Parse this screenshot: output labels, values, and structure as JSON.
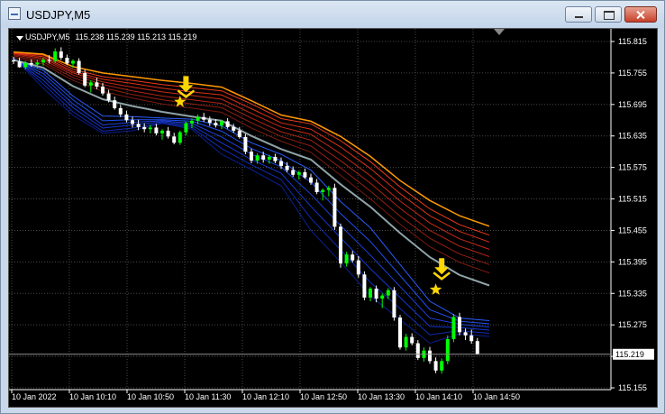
{
  "window": {
    "title": "USDJPY,M5"
  },
  "chart_header": {
    "symbol": "USDJPY,M5",
    "ohlc": "115.238 115.239 115.213 115.219"
  },
  "chart_data": {
    "type": "candlestick",
    "y_ticks": [
      "115.815",
      "115.755",
      "115.695",
      "115.635",
      "115.575",
      "115.515",
      "115.455",
      "115.395",
      "115.335",
      "115.275",
      "115.215",
      "115.155"
    ],
    "x_ticks": [
      "10 Jan 2022",
      "10 Jan 10:10",
      "10 Jan 10:50",
      "10 Jan 11:30",
      "10 Jan 12:10",
      "10 Jan 12:50",
      "10 Jan 13:30",
      "10 Jan 14:10",
      "10 Jan 14:50"
    ],
    "ylim": [
      115.155,
      115.815
    ],
    "current_price": "115.219",
    "grid": true,
    "colors": {
      "background": "#000000",
      "bull": "#00ff00",
      "bear": "#ffffff",
      "grid": "#4a4a4a",
      "signal": "#ffd700",
      "ema_fast": "#0033ff",
      "ema_slow": "#ff2a00",
      "ema_top": "#ff9900",
      "ema_mid": "#8fa3a8"
    },
    "candles": [
      [
        115.779,
        115.786,
        115.772,
        115.777
      ],
      [
        115.777,
        115.784,
        115.765,
        115.766
      ],
      [
        115.766,
        115.778,
        115.762,
        115.774
      ],
      [
        115.774,
        115.781,
        115.767,
        115.771
      ],
      [
        115.771,
        115.78,
        115.764,
        115.775
      ],
      [
        115.775,
        115.784,
        115.769,
        115.78
      ],
      [
        115.78,
        115.789,
        115.773,
        115.778
      ],
      [
        115.778,
        115.802,
        115.774,
        115.796
      ],
      [
        115.796,
        115.804,
        115.78,
        115.784
      ],
      [
        115.784,
        115.79,
        115.77,
        115.773
      ],
      [
        115.773,
        115.781,
        115.765,
        115.778
      ],
      [
        115.778,
        115.783,
        115.752,
        115.755
      ],
      [
        115.755,
        115.761,
        115.728,
        115.731
      ],
      [
        115.731,
        115.741,
        115.718,
        115.737
      ],
      [
        115.737,
        115.746,
        115.724,
        115.729
      ],
      [
        115.729,
        115.736,
        115.712,
        115.716
      ],
      [
        115.716,
        115.723,
        115.699,
        115.703
      ],
      [
        115.703,
        115.71,
        115.685,
        115.688
      ],
      [
        115.688,
        115.694,
        115.671,
        115.676
      ],
      [
        115.676,
        115.683,
        115.661,
        115.665
      ],
      [
        115.665,
        115.672,
        115.651,
        115.658
      ],
      [
        115.658,
        115.666,
        115.646,
        115.652
      ],
      [
        115.652,
        115.659,
        115.642,
        115.648
      ],
      [
        115.648,
        115.656,
        115.64,
        115.651
      ],
      [
        115.651,
        115.658,
        115.636,
        115.64
      ],
      [
        115.64,
        115.648,
        115.628,
        115.645
      ],
      [
        115.645,
        115.652,
        115.63,
        115.634
      ],
      [
        115.634,
        115.641,
        115.619,
        115.622
      ],
      [
        115.622,
        115.645,
        115.618,
        115.642
      ],
      [
        115.642,
        115.662,
        115.636,
        115.659
      ],
      [
        115.659,
        115.668,
        115.65,
        115.664
      ],
      [
        115.664,
        115.676,
        115.657,
        115.671
      ],
      [
        115.671,
        115.679,
        115.662,
        115.666
      ],
      [
        115.666,
        115.672,
        115.654,
        115.66
      ],
      [
        115.66,
        115.667,
        115.651,
        115.655
      ],
      [
        115.655,
        115.666,
        115.648,
        115.663
      ],
      [
        115.663,
        115.669,
        115.649,
        115.652
      ],
      [
        115.652,
        115.658,
        115.641,
        115.645
      ],
      [
        115.645,
        115.652,
        115.63,
        115.633
      ],
      [
        115.633,
        115.639,
        115.6,
        115.605
      ],
      [
        115.605,
        115.611,
        115.583,
        115.588
      ],
      [
        115.588,
        115.602,
        115.582,
        115.598
      ],
      [
        115.598,
        115.605,
        115.584,
        115.59
      ],
      [
        115.59,
        115.599,
        115.582,
        115.595
      ],
      [
        115.595,
        115.601,
        115.583,
        115.587
      ],
      [
        115.587,
        115.594,
        115.572,
        115.578
      ],
      [
        115.578,
        115.585,
        115.566,
        115.57
      ],
      [
        115.57,
        115.577,
        115.557,
        115.561
      ],
      [
        115.561,
        115.569,
        115.552,
        115.566
      ],
      [
        115.566,
        115.573,
        115.553,
        115.556
      ],
      [
        115.556,
        115.563,
        115.542,
        115.546
      ],
      [
        115.546,
        115.553,
        115.524,
        115.528
      ],
      [
        115.528,
        115.535,
        115.512,
        115.532
      ],
      [
        115.532,
        115.54,
        115.52,
        115.536
      ],
      [
        115.536,
        115.544,
        115.456,
        115.462
      ],
      [
        115.462,
        115.468,
        115.384,
        115.392
      ],
      [
        115.392,
        115.414,
        115.386,
        115.409
      ],
      [
        115.409,
        115.416,
        115.394,
        115.398
      ],
      [
        115.398,
        115.406,
        115.365,
        115.371
      ],
      [
        115.371,
        115.377,
        115.322,
        115.327
      ],
      [
        115.327,
        115.347,
        115.32,
        115.344
      ],
      [
        115.344,
        115.35,
        115.318,
        115.325
      ],
      [
        115.325,
        115.335,
        115.307,
        115.331
      ],
      [
        115.331,
        115.345,
        115.324,
        115.341
      ],
      [
        115.341,
        115.347,
        115.283,
        115.289
      ],
      [
        115.289,
        115.294,
        115.228,
        115.232
      ],
      [
        115.232,
        115.258,
        115.226,
        115.252
      ],
      [
        115.252,
        115.259,
        115.236,
        115.24
      ],
      [
        115.24,
        115.246,
        115.208,
        115.212
      ],
      [
        115.212,
        115.232,
        115.205,
        115.226
      ],
      [
        115.226,
        115.233,
        115.201,
        115.206
      ],
      [
        115.206,
        115.213,
        115.183,
        115.188
      ],
      [
        115.188,
        115.211,
        115.182,
        115.206
      ],
      [
        115.206,
        115.255,
        115.2,
        115.248
      ],
      [
        115.248,
        115.296,
        115.242,
        115.29
      ],
      [
        115.29,
        115.298,
        115.255,
        115.261
      ],
      [
        115.261,
        115.268,
        115.246,
        115.255
      ],
      [
        115.255,
        115.266,
        115.239,
        115.244
      ],
      [
        115.244,
        115.25,
        115.218,
        115.219
      ]
    ],
    "ema_fast": [
      [
        115.785,
        115.726,
        115.674,
        115.64,
        115.645,
        115.659,
        115.648,
        115.6,
        115.571,
        115.54,
        115.455,
        115.395,
        115.33,
        115.285,
        115.24,
        115.258,
        115.253
      ],
      [
        115.784,
        115.734,
        115.681,
        115.644,
        115.65,
        115.66,
        115.651,
        115.611,
        115.58,
        115.552,
        115.478,
        115.418,
        115.356,
        115.306,
        115.256,
        115.264,
        115.259
      ],
      [
        115.783,
        115.741,
        115.689,
        115.65,
        115.656,
        115.662,
        115.655,
        115.622,
        115.59,
        115.564,
        115.501,
        115.441,
        115.382,
        115.327,
        115.272,
        115.27,
        115.265
      ],
      [
        115.782,
        115.748,
        115.696,
        115.656,
        115.661,
        115.664,
        115.659,
        115.633,
        115.6,
        115.576,
        115.524,
        115.464,
        115.408,
        115.348,
        115.288,
        115.276,
        115.271
      ],
      [
        115.781,
        115.754,
        115.704,
        115.664,
        115.666,
        115.666,
        115.663,
        115.644,
        115.611,
        115.588,
        115.547,
        115.487,
        115.434,
        115.369,
        115.304,
        115.282,
        115.277
      ],
      [
        115.78,
        115.76,
        115.711,
        115.673,
        115.672,
        115.669,
        115.667,
        115.654,
        115.622,
        115.6,
        115.57,
        115.51,
        115.46,
        115.39,
        115.32,
        115.288,
        115.283
      ]
    ],
    "ema_mid": [
      115.78,
      115.765,
      115.73,
      115.705,
      115.692,
      115.681,
      115.672,
      115.664,
      115.635,
      115.61,
      115.59,
      115.543,
      115.5,
      115.45,
      115.404,
      115.37,
      115.35
    ],
    "ema_slow": [
      [
        115.785,
        115.772,
        115.741,
        115.72,
        115.707,
        115.696,
        115.688,
        115.68,
        115.65,
        115.625,
        115.604,
        115.56,
        115.515,
        115.467,
        115.424,
        115.394,
        115.374
      ],
      [
        115.788,
        115.776,
        115.746,
        115.727,
        115.714,
        115.704,
        115.696,
        115.689,
        115.66,
        115.634,
        115.616,
        115.574,
        115.53,
        115.482,
        115.44,
        115.41,
        115.39
      ],
      [
        115.79,
        115.78,
        115.751,
        115.733,
        115.721,
        115.711,
        115.704,
        115.697,
        115.669,
        115.643,
        115.627,
        115.588,
        115.545,
        115.497,
        115.455,
        115.425,
        115.405
      ],
      [
        115.792,
        115.783,
        115.755,
        115.738,
        115.728,
        115.719,
        115.712,
        115.705,
        115.678,
        115.652,
        115.638,
        115.601,
        115.559,
        115.511,
        115.469,
        115.439,
        115.419
      ],
      [
        115.793,
        115.786,
        115.758,
        115.743,
        115.735,
        115.726,
        115.719,
        115.713,
        115.687,
        115.66,
        115.648,
        115.614,
        115.573,
        115.525,
        115.483,
        115.453,
        115.433
      ],
      [
        115.794,
        115.789,
        115.762,
        115.748,
        115.741,
        115.733,
        115.727,
        115.721,
        115.696,
        115.668,
        115.658,
        115.626,
        115.586,
        115.538,
        115.496,
        115.466,
        115.446
      ]
    ],
    "ema_top": [
      115.795,
      115.791,
      115.767,
      115.755,
      115.748,
      115.741,
      115.735,
      115.728,
      115.702,
      115.675,
      115.663,
      115.634,
      115.596,
      115.55,
      115.512,
      115.483,
      115.463
    ],
    "signals": [
      {
        "type": "sell_arrow",
        "candle": 29,
        "price": 115.725
      },
      {
        "type": "star",
        "candle": 28,
        "price": 115.7
      },
      {
        "type": "sell_arrow",
        "candle": 72,
        "price": 115.378
      },
      {
        "type": "star",
        "candle": 71,
        "price": 115.342
      }
    ]
  }
}
